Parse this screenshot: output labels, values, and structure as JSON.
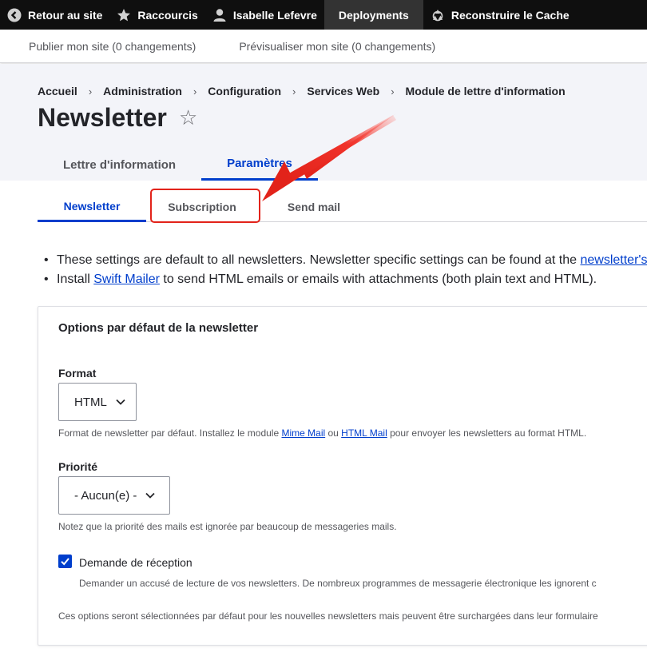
{
  "toolbar": {
    "back_label": "Retour au site",
    "shortcuts_label": "Raccourcis",
    "user_label": "Isabelle Lefevre",
    "deployments_label": "Deployments",
    "cache_label": "Reconstruire le Cache"
  },
  "tray": {
    "publish_label": "Publier mon site (0 changements)",
    "preview_label": "Prévisualiser mon site (0 changements)"
  },
  "breadcrumb": [
    "Accueil",
    "Administration",
    "Configuration",
    "Services Web",
    "Module de lettre d'information"
  ],
  "page": {
    "title": "Newsletter",
    "star": "☆"
  },
  "primary_tabs": [
    {
      "label": "Lettre d'information",
      "active": false
    },
    {
      "label": "Paramètres",
      "active": true
    }
  ],
  "secondary_tabs": [
    {
      "label": "Newsletter",
      "active": true
    },
    {
      "label": "Subscription",
      "active": false
    },
    {
      "label": "Send mail",
      "active": false
    }
  ],
  "info": {
    "line1_text": "These settings are default to all newsletters. Newsletter specific settings can be found at the ",
    "line1_link": "newsletter's",
    "line2_prefix": "Install ",
    "line2_link": "Swift Mailer",
    "line2_suffix": " to send HTML emails or emails with attachments (both plain text and HTML)."
  },
  "fieldset": {
    "title": "Options par défaut de la newsletter",
    "format": {
      "label": "Format",
      "value": "HTML",
      "desc_prefix": "Format de newsletter par défaut. Installez le module ",
      "link1": "Mime Mail",
      "desc_mid": " ou ",
      "link2": "HTML Mail",
      "desc_suffix": " pour envoyer les newsletters au format HTML."
    },
    "priority": {
      "label": "Priorité",
      "value": "- Aucun(e) -",
      "desc": "Notez que la priorité des mails est ignorée par beaucoup de messageries mails."
    },
    "receipt": {
      "label": "Demande de réception",
      "checked": true,
      "desc": "Demander un accusé de lecture de vos newsletters. De nombreux programmes de messagerie électronique les ignorent c"
    },
    "footer_note": "Ces options seront sélectionnées par défaut pour les nouvelles newsletters mais peuvent être surchargées dans leur formulaire"
  },
  "colors": {
    "accent": "#003ecc",
    "highlight": "#e2231a",
    "toolbar_bg": "#0f0f0f"
  }
}
